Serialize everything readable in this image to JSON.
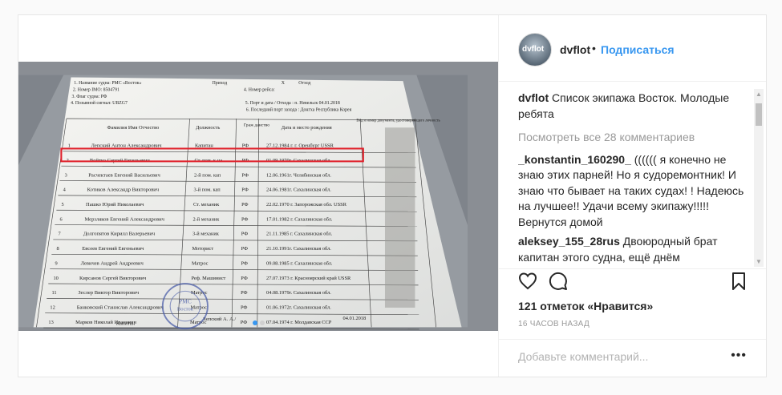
{
  "post": {
    "username": "dvflot",
    "avatar_text": "dvflot",
    "follow_label": "Подписаться",
    "separator": "•",
    "caption": "Список экипажа Восток. Молодые ребята",
    "view_all": "Посмотреть все 28 комментариев",
    "comments": [
      {
        "user": "_konstantin_160290_",
        "text": "(((((( я конечно не знаю этих парней! Но я судоремонтник! И знаю что бывает на таких судах! ! Надеюсь на лучшее!! Удачи всему экипажу!!!!! Вернутся домой"
      },
      {
        "user": "aleksey_155_28rus",
        "text": "Двоюродный брат капитан этого судна, ещё днём переписывался с ним, всё было"
      }
    ],
    "likes": "121 отметок «Нравится»",
    "time": "16 ЧАСОВ НАЗАД",
    "add_comment_placeholder": "Добавьте комментарий...",
    "more_label": "•••",
    "icons": [
      "heart-icon",
      "comment-icon",
      "bookmark-icon",
      "more-options-icon"
    ],
    "carousel": {
      "current": 1,
      "total": 2
    },
    "highlight_color": "#e0202a"
  },
  "document": {
    "header_lines": [
      "1. Название судна: РМС «Восток»",
      "2. Номер IMO: 8504791",
      "3. Флаг судна: РФ",
      "4. Позывной сигнал: UBZG7"
    ],
    "header_right": [
      "Приход",
      "X",
      "Отход",
      "4. Номер рейса:",
      "5. Порт и дата / Отхода : п. Невельск 04.01.2018",
      "6. Последний порт захода : Донгха Республика Корея"
    ],
    "columns": [
      "Фамилия Имя Отчество",
      "Должность",
      "Граж данство",
      "Дата и место рождения",
      "Вид и номер документа, удостоверяющего личность"
    ],
    "rows": [
      {
        "n": "1",
        "name": "Лепский Антон Александрович",
        "pos": "Капитан",
        "cit": "РФ",
        "birth": "27.12.1984 г. г. Оренбург USSR"
      },
      {
        "n": "2",
        "name": "Войтко Сергей Евгеньевич",
        "pos": "Ст. пом. к-на",
        "cit": "РФ",
        "birth": "01.09.1970г. Сахалинская обл."
      },
      {
        "n": "3",
        "name": "Расчектаев Евгений Васильевич",
        "pos": "2-й пом. кап",
        "cit": "РФ",
        "birth": "12.06.1961г. Челябинская обл."
      },
      {
        "n": "4",
        "name": "Котиков Александр Викторович",
        "pos": "3-й пом. кап",
        "cit": "РФ",
        "birth": "24.06.1981г. Сахалинская обл."
      },
      {
        "n": "5",
        "name": "Пашко Юрий Николаевич",
        "pos": "Ст. механик",
        "cit": "РФ",
        "birth": "22.02.1970 г. Запорожская обл. USSR"
      },
      {
        "n": "6",
        "name": "Мерзляков Евгений Александрович",
        "pos": "2-й механик",
        "cit": "РФ",
        "birth": "17.01.1982 г. Сахалинская обл."
      },
      {
        "n": "7",
        "name": "Долгопятов Кирилл Валерьевич",
        "pos": "3-й механик",
        "cit": "РФ",
        "birth": "21.11.1985 г. Сахалинская обл."
      },
      {
        "n": "8",
        "name": "Евсеев Евгений Евгеньевич",
        "pos": "Моторист",
        "cit": "РФ",
        "birth": "21.10.1991г. Сахалинская обл."
      },
      {
        "n": "9",
        "name": "Левичев Андрей Андреевич",
        "pos": "Матрос",
        "cit": "РФ",
        "birth": "09.08.1985 г. Сахалинская обл."
      },
      {
        "n": "10",
        "name": "Кирсанов Сергей Викторович",
        "pos": "Реф. Машинист",
        "cit": "РФ",
        "birth": "27.07.1973 г. Красноярский край USSR"
      },
      {
        "n": "11",
        "name": "Зеслер Виктор Викторович",
        "pos": "Матрос",
        "cit": "РФ",
        "birth": "04.08.1979г. Сахалинская обл."
      },
      {
        "n": "12",
        "name": "Банковский Станислав Александрович",
        "pos": "Матрос",
        "cit": "РФ",
        "birth": "01.06.1972г. Сахалинская обл."
      },
      {
        "n": "13",
        "name": "Марков Николай Иванович",
        "pos": "Матрос",
        "cit": "РФ",
        "birth": "07.04.1974 г. Молдавская ССР"
      }
    ],
    "footer_left": "Капитан",
    "footer_mid": "Лепский А. А./",
    "footer_right": "04.01.2018",
    "stamp_lines": [
      "РМС",
      "Восток"
    ]
  }
}
